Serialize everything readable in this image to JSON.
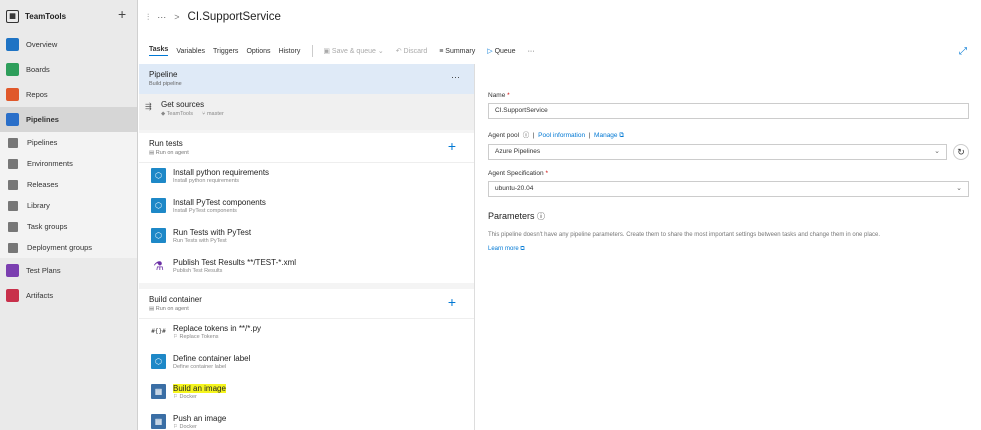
{
  "org": {
    "name": "TeamTools",
    "add": "+"
  },
  "nav": {
    "overview": "Overview",
    "boards": "Boards",
    "repos": "Repos",
    "pipelines": "Pipelines",
    "sub": [
      "Pipelines",
      "Environments",
      "Releases",
      "Library",
      "Task groups",
      "Deployment groups"
    ],
    "testplans": "Test Plans",
    "artifacts": "Artifacts"
  },
  "header": {
    "more": "···",
    "chevron": ">",
    "title": "CI.SupportService"
  },
  "toolbar": {
    "tabs": [
      "Tasks",
      "Variables",
      "Triggers",
      "Options",
      "History"
    ],
    "save": "Save & queue",
    "discard": "Discard",
    "summary": "Summary",
    "queue": "Queue",
    "more": "···"
  },
  "pipeline": {
    "title": "Pipeline",
    "subtitle": "Build pipeline",
    "more": "···"
  },
  "getsources": {
    "title": "Get sources",
    "repo": "TeamTools",
    "branch": "master"
  },
  "phases": [
    {
      "title": "Run tests",
      "subtitle": "Run on agent",
      "tasks": [
        {
          "title": "Install python requirements",
          "subtitle": "Install python requirements"
        },
        {
          "title": "Install PyTest components",
          "subtitle": "Install PyTest components"
        },
        {
          "title": "Run Tests with PyTest",
          "subtitle": "Run Tests with PyTest"
        },
        {
          "title": "Publish Test Results **/TEST-*.xml",
          "subtitle": "Publish Test Results"
        }
      ]
    },
    {
      "title": "Build container",
      "subtitle": "Run on agent",
      "tasks": [
        {
          "title": "Replace tokens in **/*.py",
          "subtitle": "Replace Tokens"
        },
        {
          "title": "Define container label",
          "subtitle": "Define container label"
        },
        {
          "title": "Build an image",
          "subtitle": "Docker"
        },
        {
          "title": "Push an image",
          "subtitle": "Docker"
        }
      ]
    }
  ],
  "form": {
    "name_label": "Name",
    "name_value": "CI.SupportService",
    "pool_label": "Agent pool",
    "pool_info": "Pool information",
    "manage": "Manage",
    "pool_value": "Azure Pipelines",
    "spec_label": "Agent Specification",
    "spec_value": "ubuntu-20.04",
    "params_title": "Parameters",
    "params_desc": "This pipeline doesn't have any pipeline parameters. Create them to share the most important settings between tasks and change them in one place.",
    "learn_more": "Learn more"
  }
}
